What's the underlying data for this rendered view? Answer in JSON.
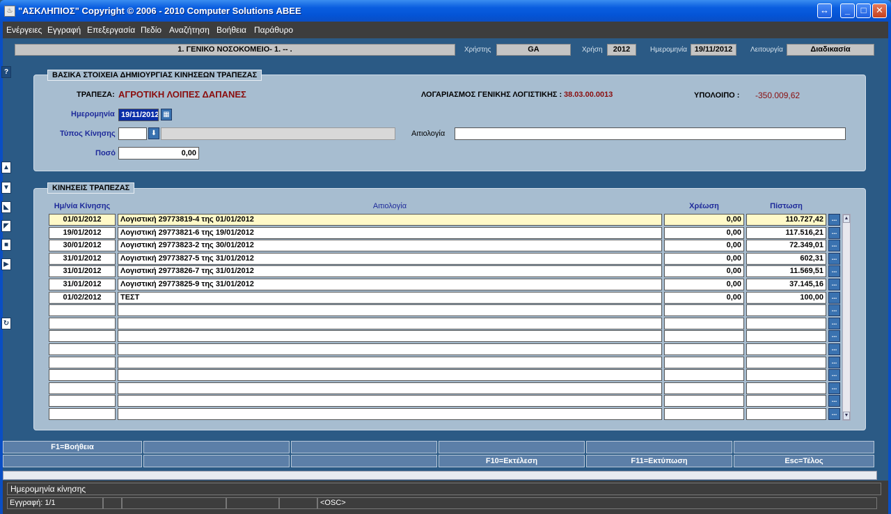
{
  "window": {
    "title": "\"ΑΣΚΛΗΠΙΟΣ\" Copyright © 2006 - 2010 Computer Solutions ΑΒΕΕ",
    "icon": "java-app-icon"
  },
  "menu": [
    "Ενέργειες",
    "Εγγραφή",
    "Επεξεργασία",
    "Πεδίο",
    "Αναζήτηση",
    "Βοήθεια",
    "Παράθυρο"
  ],
  "header": {
    "organization": "1. ΓΕΝΙΚΟ ΝΟΣΟΚΟΜΕΙΟ- 1. -- .",
    "user_label": "Χρήστης",
    "user": "GA",
    "year_label": "Χρήση",
    "year": "2012",
    "date_label": "Ημερομηνία",
    "date": "19/11/2012",
    "function_label": "Λειτουργία",
    "function": "Διαδικασία"
  },
  "basic": {
    "panel_title": "ΒΑΣΙΚΑ ΣΤΟΙΧΕΙΑ ΔΗΜΙΟΥΡΓΙΑΣ ΚΙΝΗΣΕΩΝ ΤΡΑΠΕΖΑΣ",
    "bank_label": "ΤΡΑΠΕΖΑ:",
    "bank_value": "ΑΓΡΟΤΙΚΗ ΛΟΙΠΕΣ ΔΑΠΑΝΕΣ",
    "account_label": "ΛΟΓΑΡΙΑΣΜΟΣ ΓΕΝΙΚΗΣ ΛΟΓΙΣΤΙΚΗΣ :",
    "account_value": "38.03.00.0013",
    "balance_label": "ΥΠΟΛΟΙΠΟ :",
    "balance_value": "-350.009,62",
    "date_label": "Ημερομηνία",
    "date_value": "19/11/2012",
    "type_label": "Τύπος Κίνησης",
    "type_code": "",
    "type_desc": "",
    "reason_label": "Αιτιολογία",
    "reason_value": "",
    "amount_label": "Ποσό",
    "amount_value": "0,00"
  },
  "movements": {
    "panel_title": "ΚΙΝΗΣΕΙΣ ΤΡΑΠΕΖΑΣ",
    "columns": [
      "Ημ/νία Κίνησης",
      "Αιτιολογία",
      "Χρέωση",
      "Πίστωση"
    ],
    "rows": [
      {
        "date": "01/01/2012",
        "reason": "Λογιστική 29773819-4 της 01/01/2012",
        "debit": "0,00",
        "credit": "110.727,42"
      },
      {
        "date": "19/01/2012",
        "reason": "Λογιστική 29773821-6 της 19/01/2012",
        "debit": "0,00",
        "credit": "117.516,21"
      },
      {
        "date": "30/01/2012",
        "reason": "Λογιστική 29773823-2 της 30/01/2012",
        "debit": "0,00",
        "credit": "72.349,01"
      },
      {
        "date": "31/01/2012",
        "reason": "Λογιστική 29773827-5 της 31/01/2012",
        "debit": "0,00",
        "credit": "602,31"
      },
      {
        "date": "31/01/2012",
        "reason": "Λογιστική 29773826-7 της 31/01/2012",
        "debit": "0,00",
        "credit": "11.569,51"
      },
      {
        "date": "31/01/2012",
        "reason": "Λογιστική 29773825-9 της 31/01/2012",
        "debit": "0,00",
        "credit": "37.145,16"
      },
      {
        "date": "01/02/2012",
        "reason": "ΤΕΣΤ",
        "debit": "0,00",
        "credit": "100,00"
      },
      {
        "date": "",
        "reason": "",
        "debit": "",
        "credit": ""
      },
      {
        "date": "",
        "reason": "",
        "debit": "",
        "credit": ""
      },
      {
        "date": "",
        "reason": "",
        "debit": "",
        "credit": ""
      },
      {
        "date": "",
        "reason": "",
        "debit": "",
        "credit": ""
      },
      {
        "date": "",
        "reason": "",
        "debit": "",
        "credit": ""
      },
      {
        "date": "",
        "reason": "",
        "debit": "",
        "credit": ""
      },
      {
        "date": "",
        "reason": "",
        "debit": "",
        "credit": ""
      },
      {
        "date": "",
        "reason": "",
        "debit": "",
        "credit": ""
      },
      {
        "date": "",
        "reason": "",
        "debit": "",
        "credit": ""
      }
    ],
    "row_button": "..."
  },
  "fkeys": {
    "row1": [
      "F1=Βοήθεια",
      "",
      "",
      "",
      "",
      ""
    ],
    "row2": [
      "",
      "",
      "",
      "F10=Εκτέλεση",
      "F11=Εκτύπωση",
      "Esc=Τέλος"
    ]
  },
  "status": {
    "message": "Ημερομηνία κίνησης",
    "record": "Εγγραφή: 1/1",
    "mode": "<OSC>"
  },
  "colors": {
    "background": "#2b5a85",
    "panel": "#a7bdd0",
    "label_blue": "#1e2a9a",
    "value_red": "#8a0d0d",
    "current_row": "#fff9c8"
  }
}
